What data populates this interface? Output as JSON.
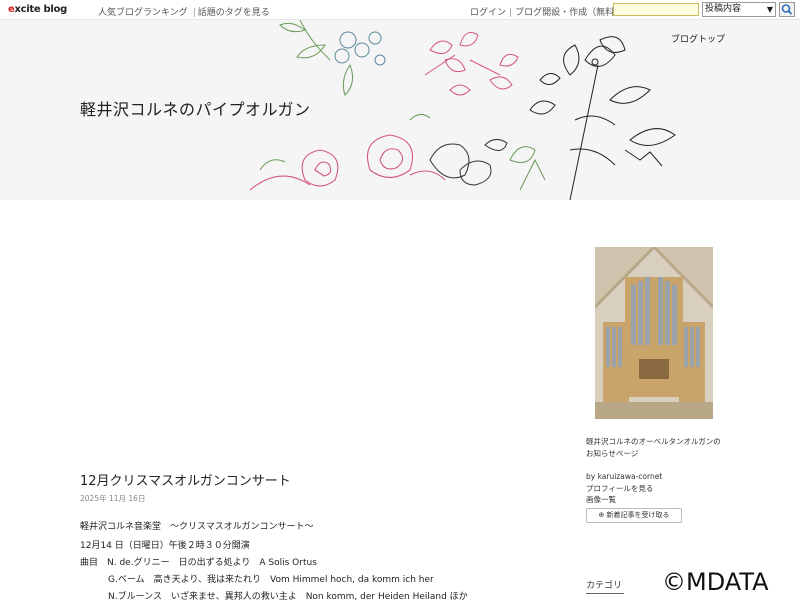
{
  "topbar": {
    "logo_prefix": "e",
    "logo_rest": "xcite blog",
    "links": [
      "人気ブログランキング",
      "話題のタグを見る"
    ],
    "link_separator": "|",
    "right_links": [
      "ログイン",
      "ブログ開設・作成（無料）"
    ],
    "search_placeholder": "",
    "search_select": "投稿内容"
  },
  "header": {
    "blog_title": "軽井沢コルネのパイプオルガン",
    "blogtop_link": "ブログトップ"
  },
  "sidebar": {
    "description": "軽井沢コルネのオーベルタンオルガンのお知らせページ",
    "by": "by karuizawa-cornet",
    "profile_link": "プロフィールを見る",
    "images_link": "画像一覧",
    "follow_button": "新着記事を受け取る",
    "category_heading": "カテゴリ"
  },
  "post": {
    "title": "12月クリスマスオルガンコンサート",
    "date": "2025年 11月 16日",
    "lines": [
      "軽井沢コルネ音楽堂　～クリスマスオルガンコンサート～",
      "12月14 日（日曜日）午後２時３０分開演",
      "曲目　N. de.グリニー　日の出ずる処より　A Solis Ortus",
      "G.ベーム　高き天より、我は来たれり　Vom Himmel hoch, da komm ich her",
      "N.ブルーンス　いざ来ませ、異邦人の救い主よ　Non komm, der Heiden Heiland ほか"
    ]
  },
  "watermark": "©MDATA",
  "colors": {
    "header_bg": "#f5f5f5",
    "logo_accent": "#d0241d",
    "search_bg": "#fffde0"
  }
}
